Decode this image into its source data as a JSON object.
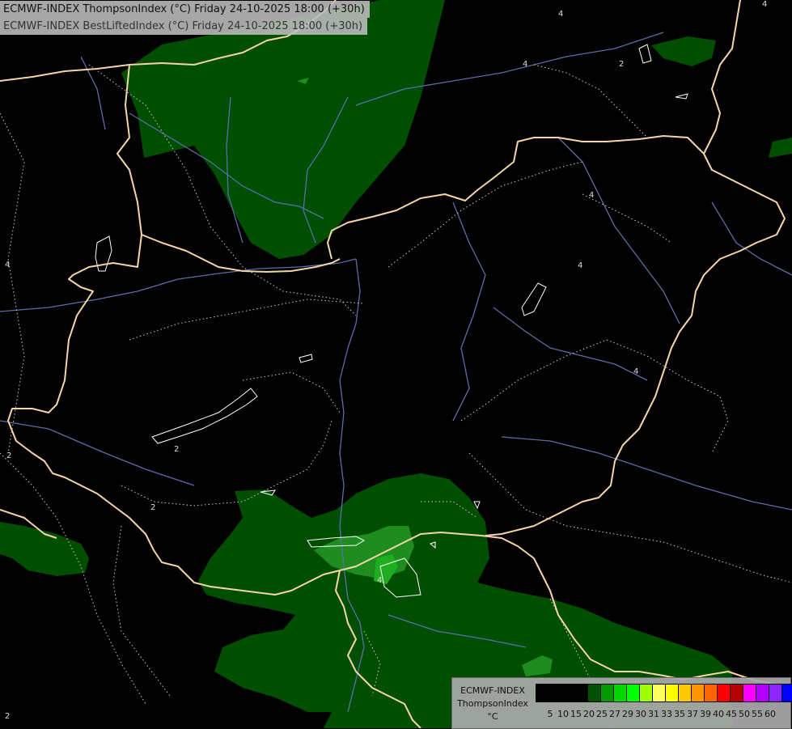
{
  "header": {
    "title_line1": "ECMWF-INDEX ThompsonIndex (°C) Friday 24-10-2025 18:00 (+30h)",
    "title_line2": "ECMWF-INDEX BestLiftedIndex (°C) Friday 24-10-2025 18:00 (+30h)"
  },
  "legend": {
    "line1": "ECMWF-INDEX",
    "line2": "ThompsonIndex",
    "unit": "°C",
    "ticks": [
      "5",
      "10",
      "15",
      "20",
      "25",
      "27",
      "29",
      "30",
      "31",
      "33",
      "35",
      "37",
      "39",
      "40",
      "45",
      "50",
      "55",
      "60"
    ],
    "colors": [
      "#000000",
      "#000000",
      "#000000",
      "#000000",
      "#005000",
      "#009a00",
      "#00d800",
      "#00ff00",
      "#a0ff00",
      "#ffff60",
      "#ffff00",
      "#ffc800",
      "#ff9600",
      "#ff6400",
      "#ff0000",
      "#b40000",
      "#ff00ff",
      "#b400ff",
      "#8c28ff",
      "#0000ff"
    ]
  },
  "contour_labels": [
    "4",
    "4",
    "2",
    "4",
    "4",
    "4",
    "4",
    "2",
    "2",
    "2",
    "2",
    "4",
    "4"
  ],
  "colors": {
    "fill_dark_green": "#004f00",
    "fill_mid_green": "#1e8c1e",
    "fill_bright_green": "#1fae1f",
    "border": "#f5d5a8",
    "river": "#5a6ea8",
    "contour": "#cccccc"
  }
}
